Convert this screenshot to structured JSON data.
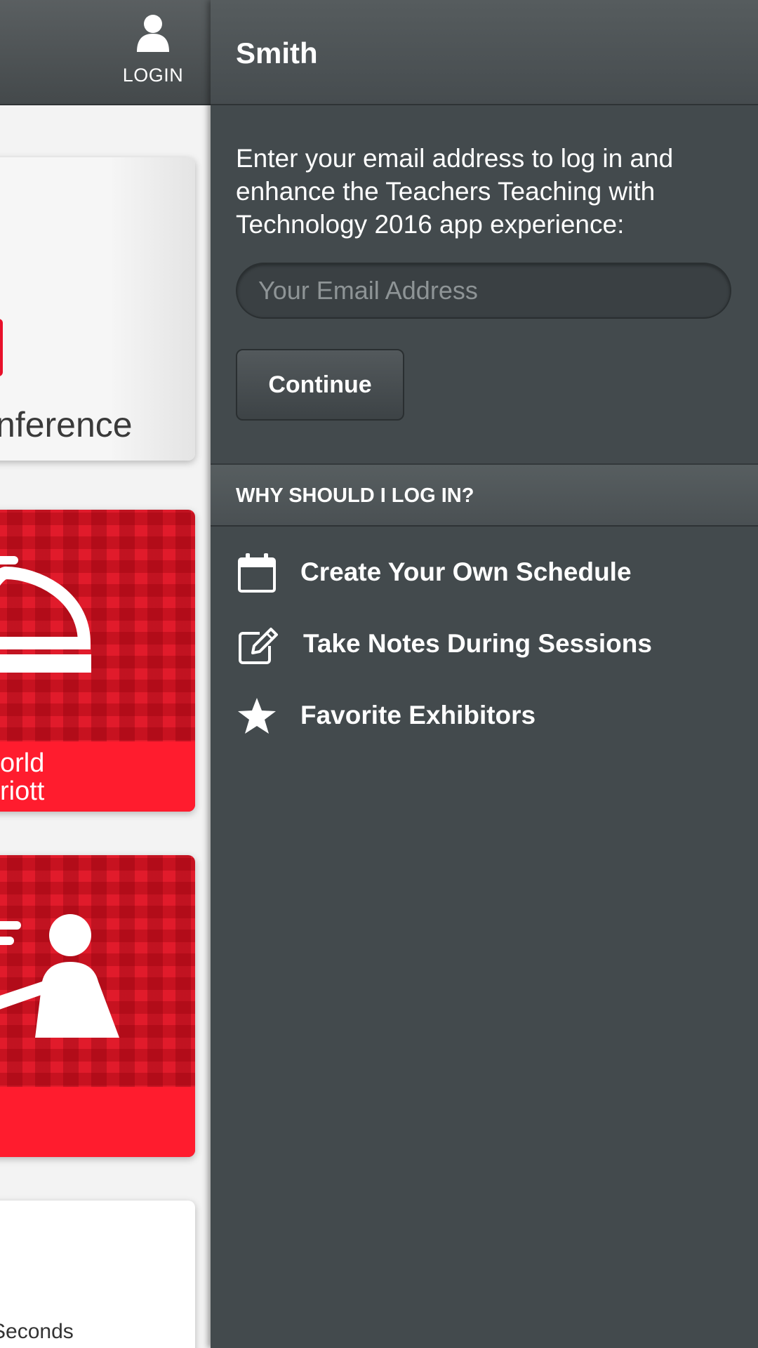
{
  "header": {
    "login_label": "LOGIN",
    "login_icon": "user-icon",
    "panel_title": "Smith"
  },
  "login": {
    "intro": "Enter your email address to log in and enhance the Teachers Teaching with Technology 2016 app experience:",
    "email_placeholder": "Your Email Address",
    "email_value": "",
    "continue_label": "Continue"
  },
  "why": {
    "title": "WHY SHOULD I LOG IN?",
    "items": [
      {
        "icon": "calendar-icon",
        "label": "Create Your Own Schedule"
      },
      {
        "icon": "edit-note-icon",
        "label": "Take Notes During Sessions"
      },
      {
        "icon": "star-icon",
        "label": "Favorite Exhibitors"
      }
    ]
  },
  "background_app": {
    "logo_text": "nference",
    "hotel_card_text": [
      "orld",
      "riott"
    ],
    "last_card_text": "Seconds"
  },
  "colors": {
    "panel_bg": "#434a4d",
    "header_bg": "#4c5254",
    "accent_red": "#e11b2b"
  }
}
